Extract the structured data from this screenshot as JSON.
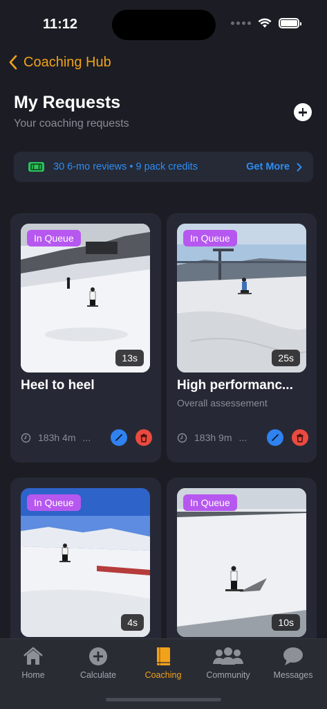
{
  "status_bar": {
    "time": "11:12"
  },
  "nav": {
    "back_label": "Coaching Hub"
  },
  "header": {
    "title": "My Requests",
    "subtitle": "Your coaching requests"
  },
  "credits": {
    "text": "30 6-mo reviews • 9 pack credits",
    "action": "Get More"
  },
  "colors": {
    "accent": "#f2a21a",
    "link": "#2e8df4",
    "badge": "#b658ef",
    "edit": "#2f82ef",
    "delete": "#ea4a3f",
    "background": "#1c1d24",
    "card": "#262935"
  },
  "requests": [
    {
      "status": "In Queue",
      "duration": "13s",
      "title": "Heel to heel",
      "subtitle": "",
      "elapsed": "183h 4m",
      "more": "..."
    },
    {
      "status": "In Queue",
      "duration": "25s",
      "title": "High performanc...",
      "subtitle": "Overall assessement",
      "elapsed": "183h 9m",
      "more": "..."
    },
    {
      "status": "In Queue",
      "duration": "4s"
    },
    {
      "status": "In Queue",
      "duration": "10s"
    }
  ],
  "tabs": [
    {
      "label": "Home",
      "icon": "home-icon"
    },
    {
      "label": "Calculate",
      "icon": "plus-circle-icon"
    },
    {
      "label": "Coaching",
      "icon": "book-icon",
      "active": true
    },
    {
      "label": "Community",
      "icon": "people-icon"
    },
    {
      "label": "Messages",
      "icon": "chat-bubble-icon"
    }
  ]
}
